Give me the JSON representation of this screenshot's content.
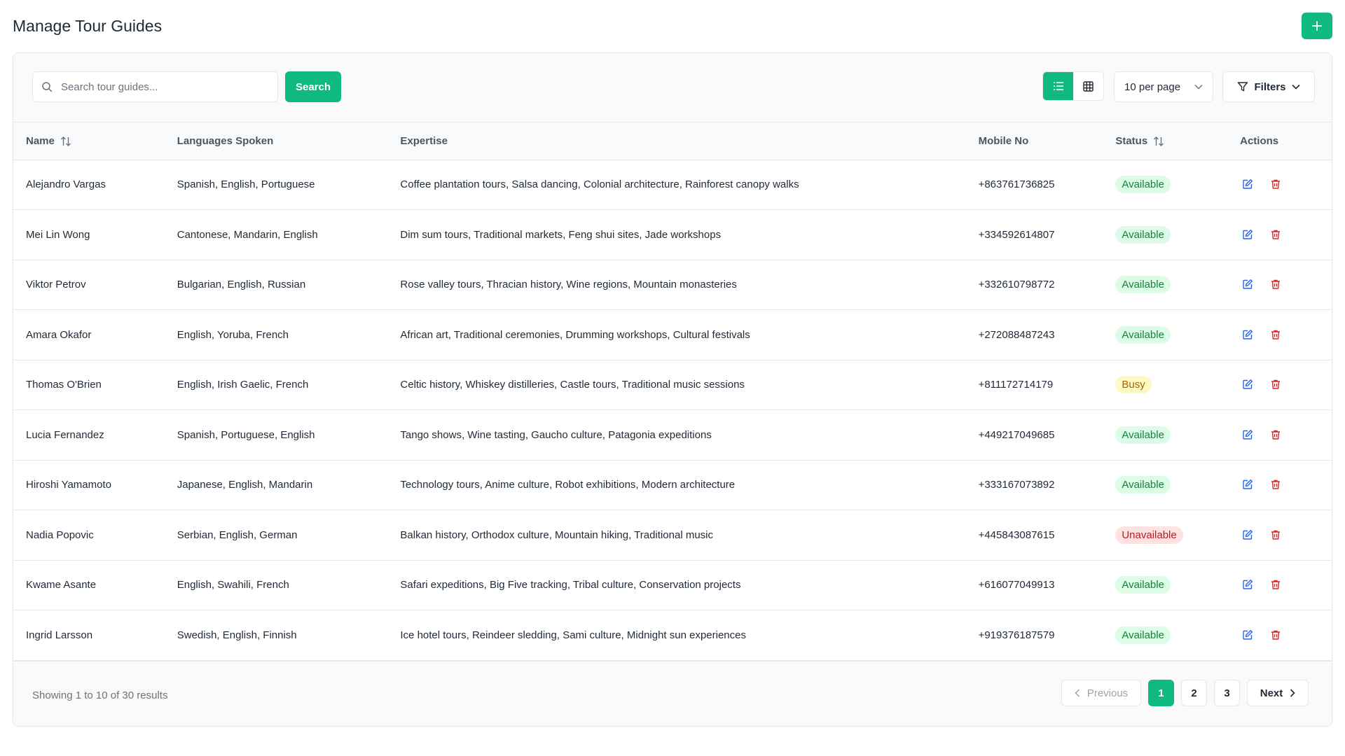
{
  "page": {
    "title": "Manage Tour Guides",
    "add_icon": "plus-icon"
  },
  "toolbar": {
    "search_placeholder": "Search tour guides...",
    "search_label": "Search",
    "per_page": "10 per page",
    "filters_label": "Filters"
  },
  "table": {
    "headers": {
      "name": "Name",
      "languages": "Languages Spoken",
      "expertise": "Expertise",
      "mobile": "Mobile No",
      "status": "Status",
      "actions": "Actions"
    },
    "rows": [
      {
        "name": "Alejandro Vargas",
        "languages": "Spanish, English, Portuguese",
        "expertise": "Coffee plantation tours, Salsa dancing, Colonial architecture, Rainforest canopy walks",
        "mobile": "+863761736825",
        "status": "Available"
      },
      {
        "name": "Mei Lin Wong",
        "languages": "Cantonese, Mandarin, English",
        "expertise": "Dim sum tours, Traditional markets, Feng shui sites, Jade workshops",
        "mobile": "+334592614807",
        "status": "Available"
      },
      {
        "name": "Viktor Petrov",
        "languages": "Bulgarian, English, Russian",
        "expertise": "Rose valley tours, Thracian history, Wine regions, Mountain monasteries",
        "mobile": "+332610798772",
        "status": "Available"
      },
      {
        "name": "Amara Okafor",
        "languages": "English, Yoruba, French",
        "expertise": "African art, Traditional ceremonies, Drumming workshops, Cultural festivals",
        "mobile": "+272088487243",
        "status": "Available"
      },
      {
        "name": "Thomas O'Brien",
        "languages": "English, Irish Gaelic, French",
        "expertise": "Celtic history, Whiskey distilleries, Castle tours, Traditional music sessions",
        "mobile": "+811172714179",
        "status": "Busy"
      },
      {
        "name": "Lucia Fernandez",
        "languages": "Spanish, Portuguese, English",
        "expertise": "Tango shows, Wine tasting, Gaucho culture, Patagonia expeditions",
        "mobile": "+449217049685",
        "status": "Available"
      },
      {
        "name": "Hiroshi Yamamoto",
        "languages": "Japanese, English, Mandarin",
        "expertise": "Technology tours, Anime culture, Robot exhibitions, Modern architecture",
        "mobile": "+333167073892",
        "status": "Available"
      },
      {
        "name": "Nadia Popovic",
        "languages": "Serbian, English, German",
        "expertise": "Balkan history, Orthodox culture, Mountain hiking, Traditional music",
        "mobile": "+445843087615",
        "status": "Unavailable"
      },
      {
        "name": "Kwame Asante",
        "languages": "English, Swahili, French",
        "expertise": "Safari expeditions, Big Five tracking, Tribal culture, Conservation projects",
        "mobile": "+616077049913",
        "status": "Available"
      },
      {
        "name": "Ingrid Larsson",
        "languages": "Swedish, English, Finnish",
        "expertise": "Ice hotel tours, Reindeer sledding, Sami culture, Midnight sun experiences",
        "mobile": "+919376187579",
        "status": "Available"
      }
    ]
  },
  "footer": {
    "showing": "Showing 1 to 10 of 30 results",
    "previous": "Previous",
    "pages": [
      "1",
      "2",
      "3"
    ],
    "next": "Next"
  },
  "colors": {
    "accent": "#10b981",
    "available": "#15803d",
    "busy": "#a16207",
    "unavailable": "#b91c1c",
    "edit_icon": "#2563eb",
    "delete_icon": "#dc2626"
  }
}
